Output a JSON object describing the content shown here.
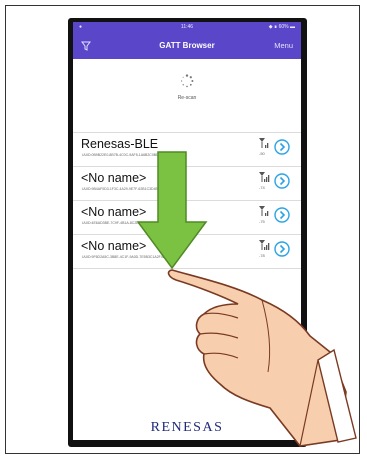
{
  "status_bar": {
    "carrier": "●",
    "time": "11:46",
    "battery": "◆ ∎ 60% ▬"
  },
  "nav": {
    "title": "GATT Browser",
    "menu_label": "Menu"
  },
  "rescan": {
    "label": "Re-scan"
  },
  "devices": [
    {
      "name": "Renesas-BLE",
      "uuid": "UUID:0B9B22E0-8B7B-4C0C-9AF5-1A6B2C0BDED0F5",
      "rssi": "-50"
    },
    {
      "name": "<No name>",
      "uuid": "UUID:9B4AF0D3-1F3C-4A29-9E7F-62B1C3D4E5F60B",
      "rssi": "-74"
    },
    {
      "name": "<No name>",
      "uuid": "UUID:4E6AD3BE-7C9F-4B1A-8C2D-1E3F5A7B9C0DAF0",
      "rssi": "-75"
    },
    {
      "name": "<No name>",
      "uuid": "UUID:9F6D2A5C-3B8E-4C1F-9A0D-7E5B3C1A2F4D6B8",
      "rssi": "-78"
    }
  ],
  "footer": {
    "brand": "RENESAS"
  },
  "colors": {
    "nav_bar": "#5a46c8",
    "info_button": "#2aa3e6",
    "arrow": "#7cc242"
  }
}
